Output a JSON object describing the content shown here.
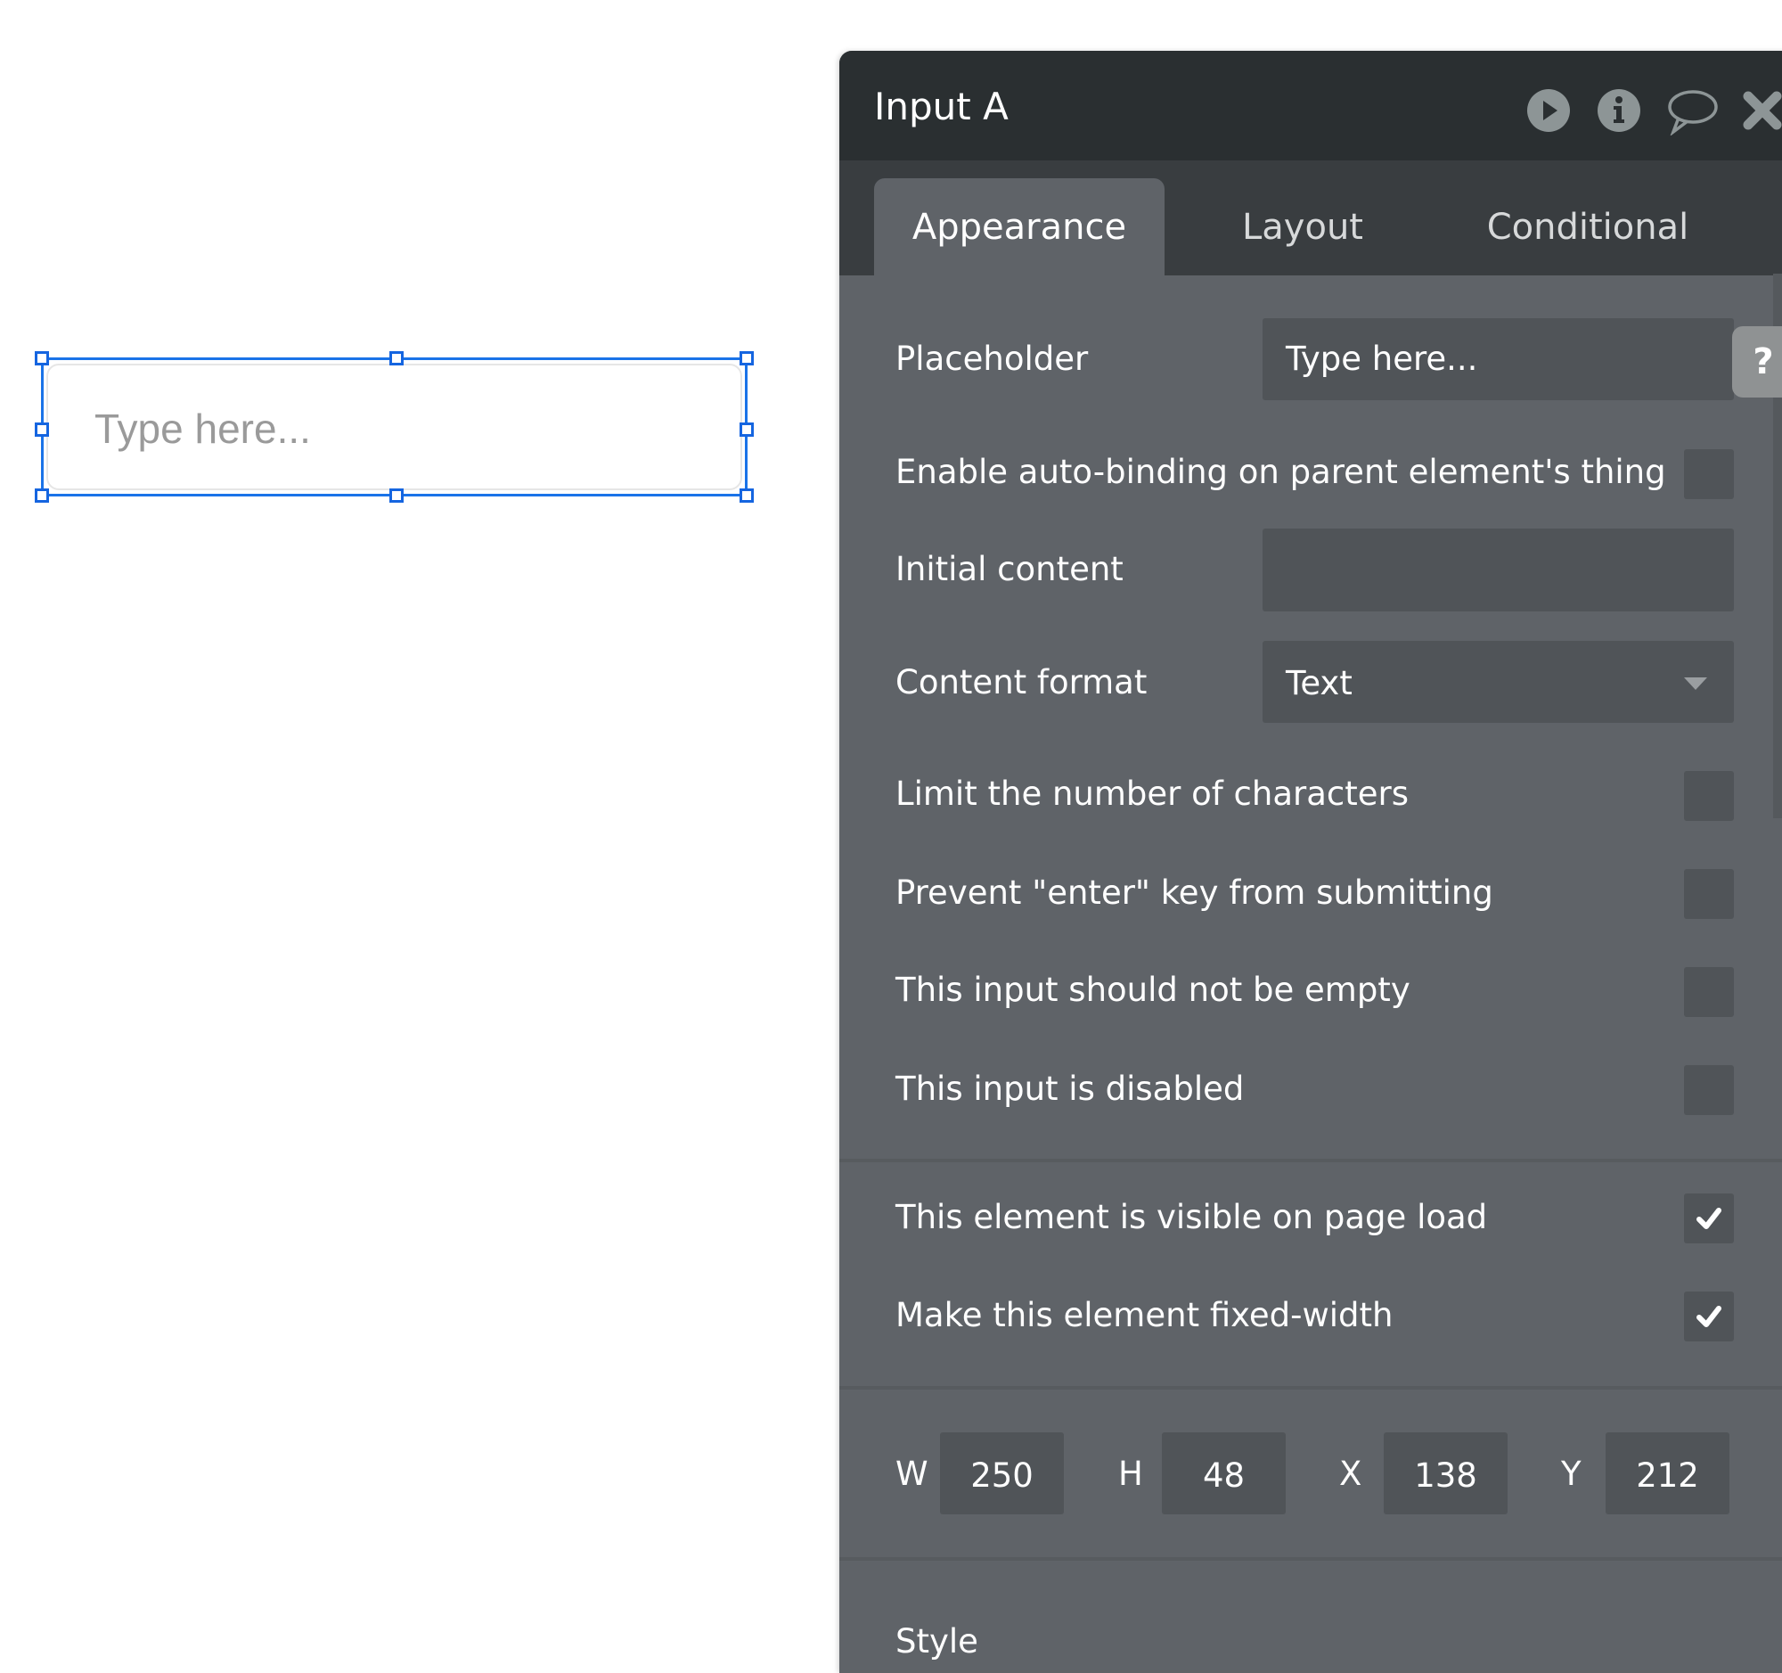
{
  "canvas": {
    "input_placeholder": "Type here..."
  },
  "panel": {
    "title": "Input A",
    "header_icons": [
      "play-icon",
      "info-icon",
      "comment-icon",
      "close-icon"
    ],
    "tabs": [
      {
        "label": "Appearance",
        "active": true
      },
      {
        "label": "Layout",
        "active": false
      },
      {
        "label": "Conditional",
        "active": false
      }
    ],
    "help_label": "?",
    "fields": {
      "placeholder": {
        "label": "Placeholder",
        "value": "Type here..."
      },
      "auto_binding": {
        "label": "Enable auto-binding on parent element's thing",
        "checked": false
      },
      "initial_content": {
        "label": "Initial content",
        "value": ""
      },
      "content_format": {
        "label": "Content format",
        "value": "Text"
      },
      "limit_chars": {
        "label": "Limit the number of characters",
        "checked": false
      },
      "prevent_enter": {
        "label": "Prevent \"enter\" key from submitting",
        "checked": false
      },
      "not_empty": {
        "label": "This input should not be empty",
        "checked": false
      },
      "disabled": {
        "label": "This input is disabled",
        "checked": false
      },
      "visible_on_load": {
        "label": "This element is visible on page load",
        "checked": true
      },
      "fixed_width": {
        "label": "Make this element fixed-width",
        "checked": true
      }
    },
    "dimensions": {
      "w_label": "W",
      "w": "250",
      "h_label": "H",
      "h": "48",
      "x_label": "X",
      "x": "138",
      "y_label": "Y",
      "y": "212"
    },
    "style_label": "Style"
  },
  "colors": {
    "selection": "#1a73e8",
    "panel_bg": "#5f6368",
    "header_bg": "#2a2f31",
    "tabbar_bg": "#393d40",
    "field_bg": "#505458"
  }
}
